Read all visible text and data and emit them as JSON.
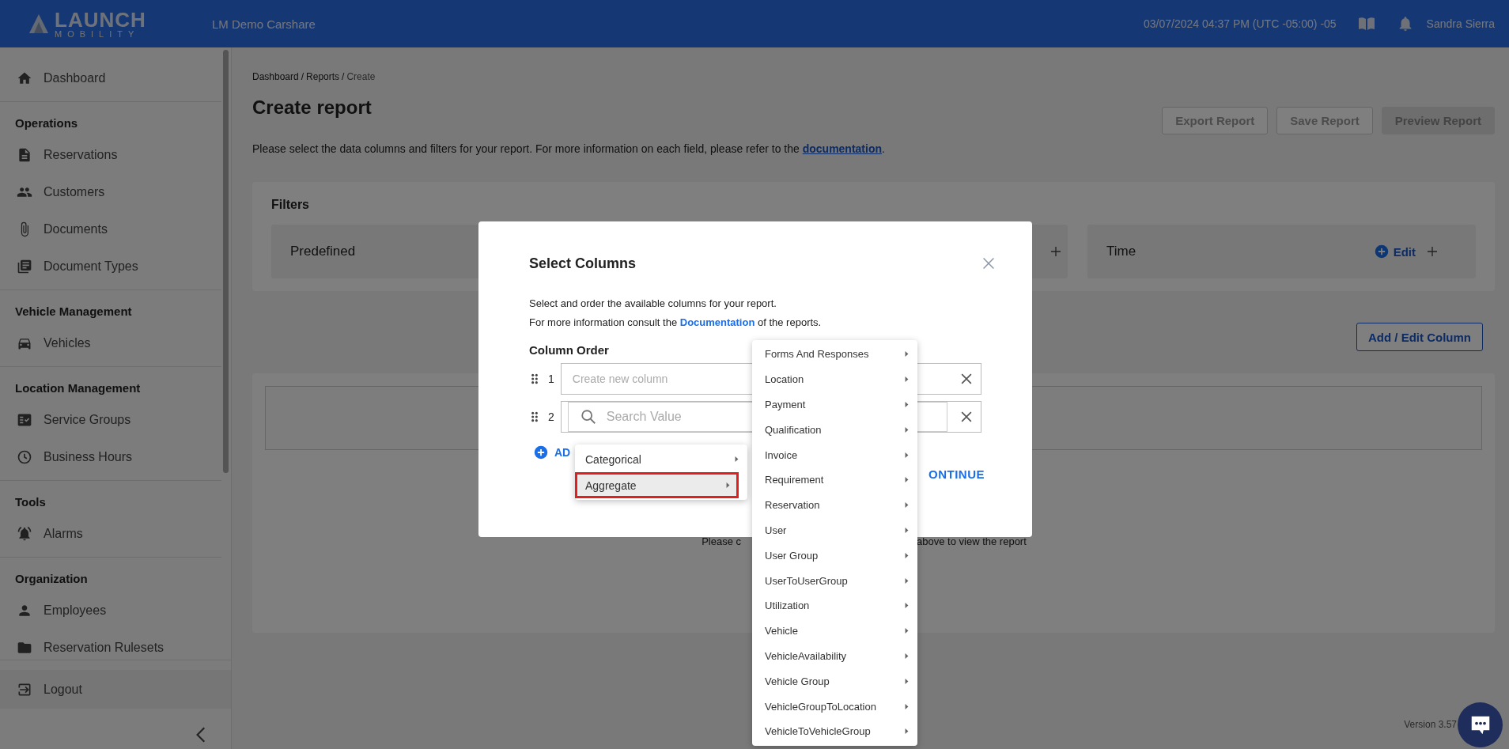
{
  "header": {
    "logo_word": "LAUNCH",
    "logo_sub": "MOBILITY",
    "org": "LM Demo Carshare",
    "datetime": "03/07/2024 04:37 PM (UTC -05:00) -05",
    "user": "Sandra Sierra"
  },
  "sidebar": {
    "sections": [
      {
        "items": [
          "Dashboard"
        ]
      },
      {
        "heading": "Operations",
        "items": [
          "Reservations",
          "Customers",
          "Documents",
          "Document Types"
        ]
      },
      {
        "heading": "Vehicle Management",
        "items": [
          "Vehicles"
        ]
      },
      {
        "heading": "Location Management",
        "items": [
          "Service Groups",
          "Business Hours"
        ]
      },
      {
        "heading": "Tools",
        "items": [
          "Alarms"
        ]
      },
      {
        "heading": "Organization",
        "items": [
          "Employees",
          "Reservation Rulesets"
        ]
      }
    ],
    "logout": "Logout"
  },
  "breadcrumb": {
    "items": [
      "Dashboard",
      "Reports",
      "Create"
    ],
    "separator": "/"
  },
  "title": "Create report",
  "actions": [
    {
      "label": "Export Report",
      "kind": "outline"
    },
    {
      "label": "Save Report",
      "kind": "outline"
    },
    {
      "label": "Preview Report",
      "kind": "filled"
    }
  ],
  "description": {
    "before": "Please select the data columns and filters for your report. For more information on each field, please refer to the ",
    "link": "documentation",
    "after": "."
  },
  "filters": {
    "title": "Filters",
    "boxes": [
      {
        "kind": "title",
        "label": "Predefined"
      },
      {
        "kind": "plus"
      },
      {
        "kind": "edit",
        "label": "Time",
        "action": "Edit"
      }
    ]
  },
  "add_edit_column": "Add / Edit Column",
  "results_hint": [
    "Please c",
    "above to view the report"
  ],
  "version": "Version 3.57",
  "modal": {
    "title": "Select Columns",
    "lines": [
      "Select and order the available columns for your report."
    ],
    "info": {
      "before": "For more information consult the ",
      "link": "Documentation",
      "after": " of the reports."
    },
    "column_order": "Column Order",
    "rows": [
      {
        "number": "1",
        "kind": "input",
        "placeholder": "Create new column"
      },
      {
        "number": "2",
        "kind": "search",
        "placeholder": "Search Value"
      }
    ],
    "add": "AD",
    "continue": "ONTINUE"
  },
  "type_menu": [
    {
      "label": "Categorical",
      "selected": false
    },
    {
      "label": "Aggregate",
      "selected": true
    }
  ],
  "submenu": [
    "Forms And Responses",
    "Location",
    "Payment",
    "Qualification",
    "Invoice",
    "Requirement",
    "Reservation",
    "User",
    "User Group",
    "UserToUserGroup",
    "Utilization",
    "Vehicle",
    "VehicleAvailability",
    "Vehicle Group",
    "VehicleGroupToLocation",
    "VehicleToVehicleGroup"
  ]
}
